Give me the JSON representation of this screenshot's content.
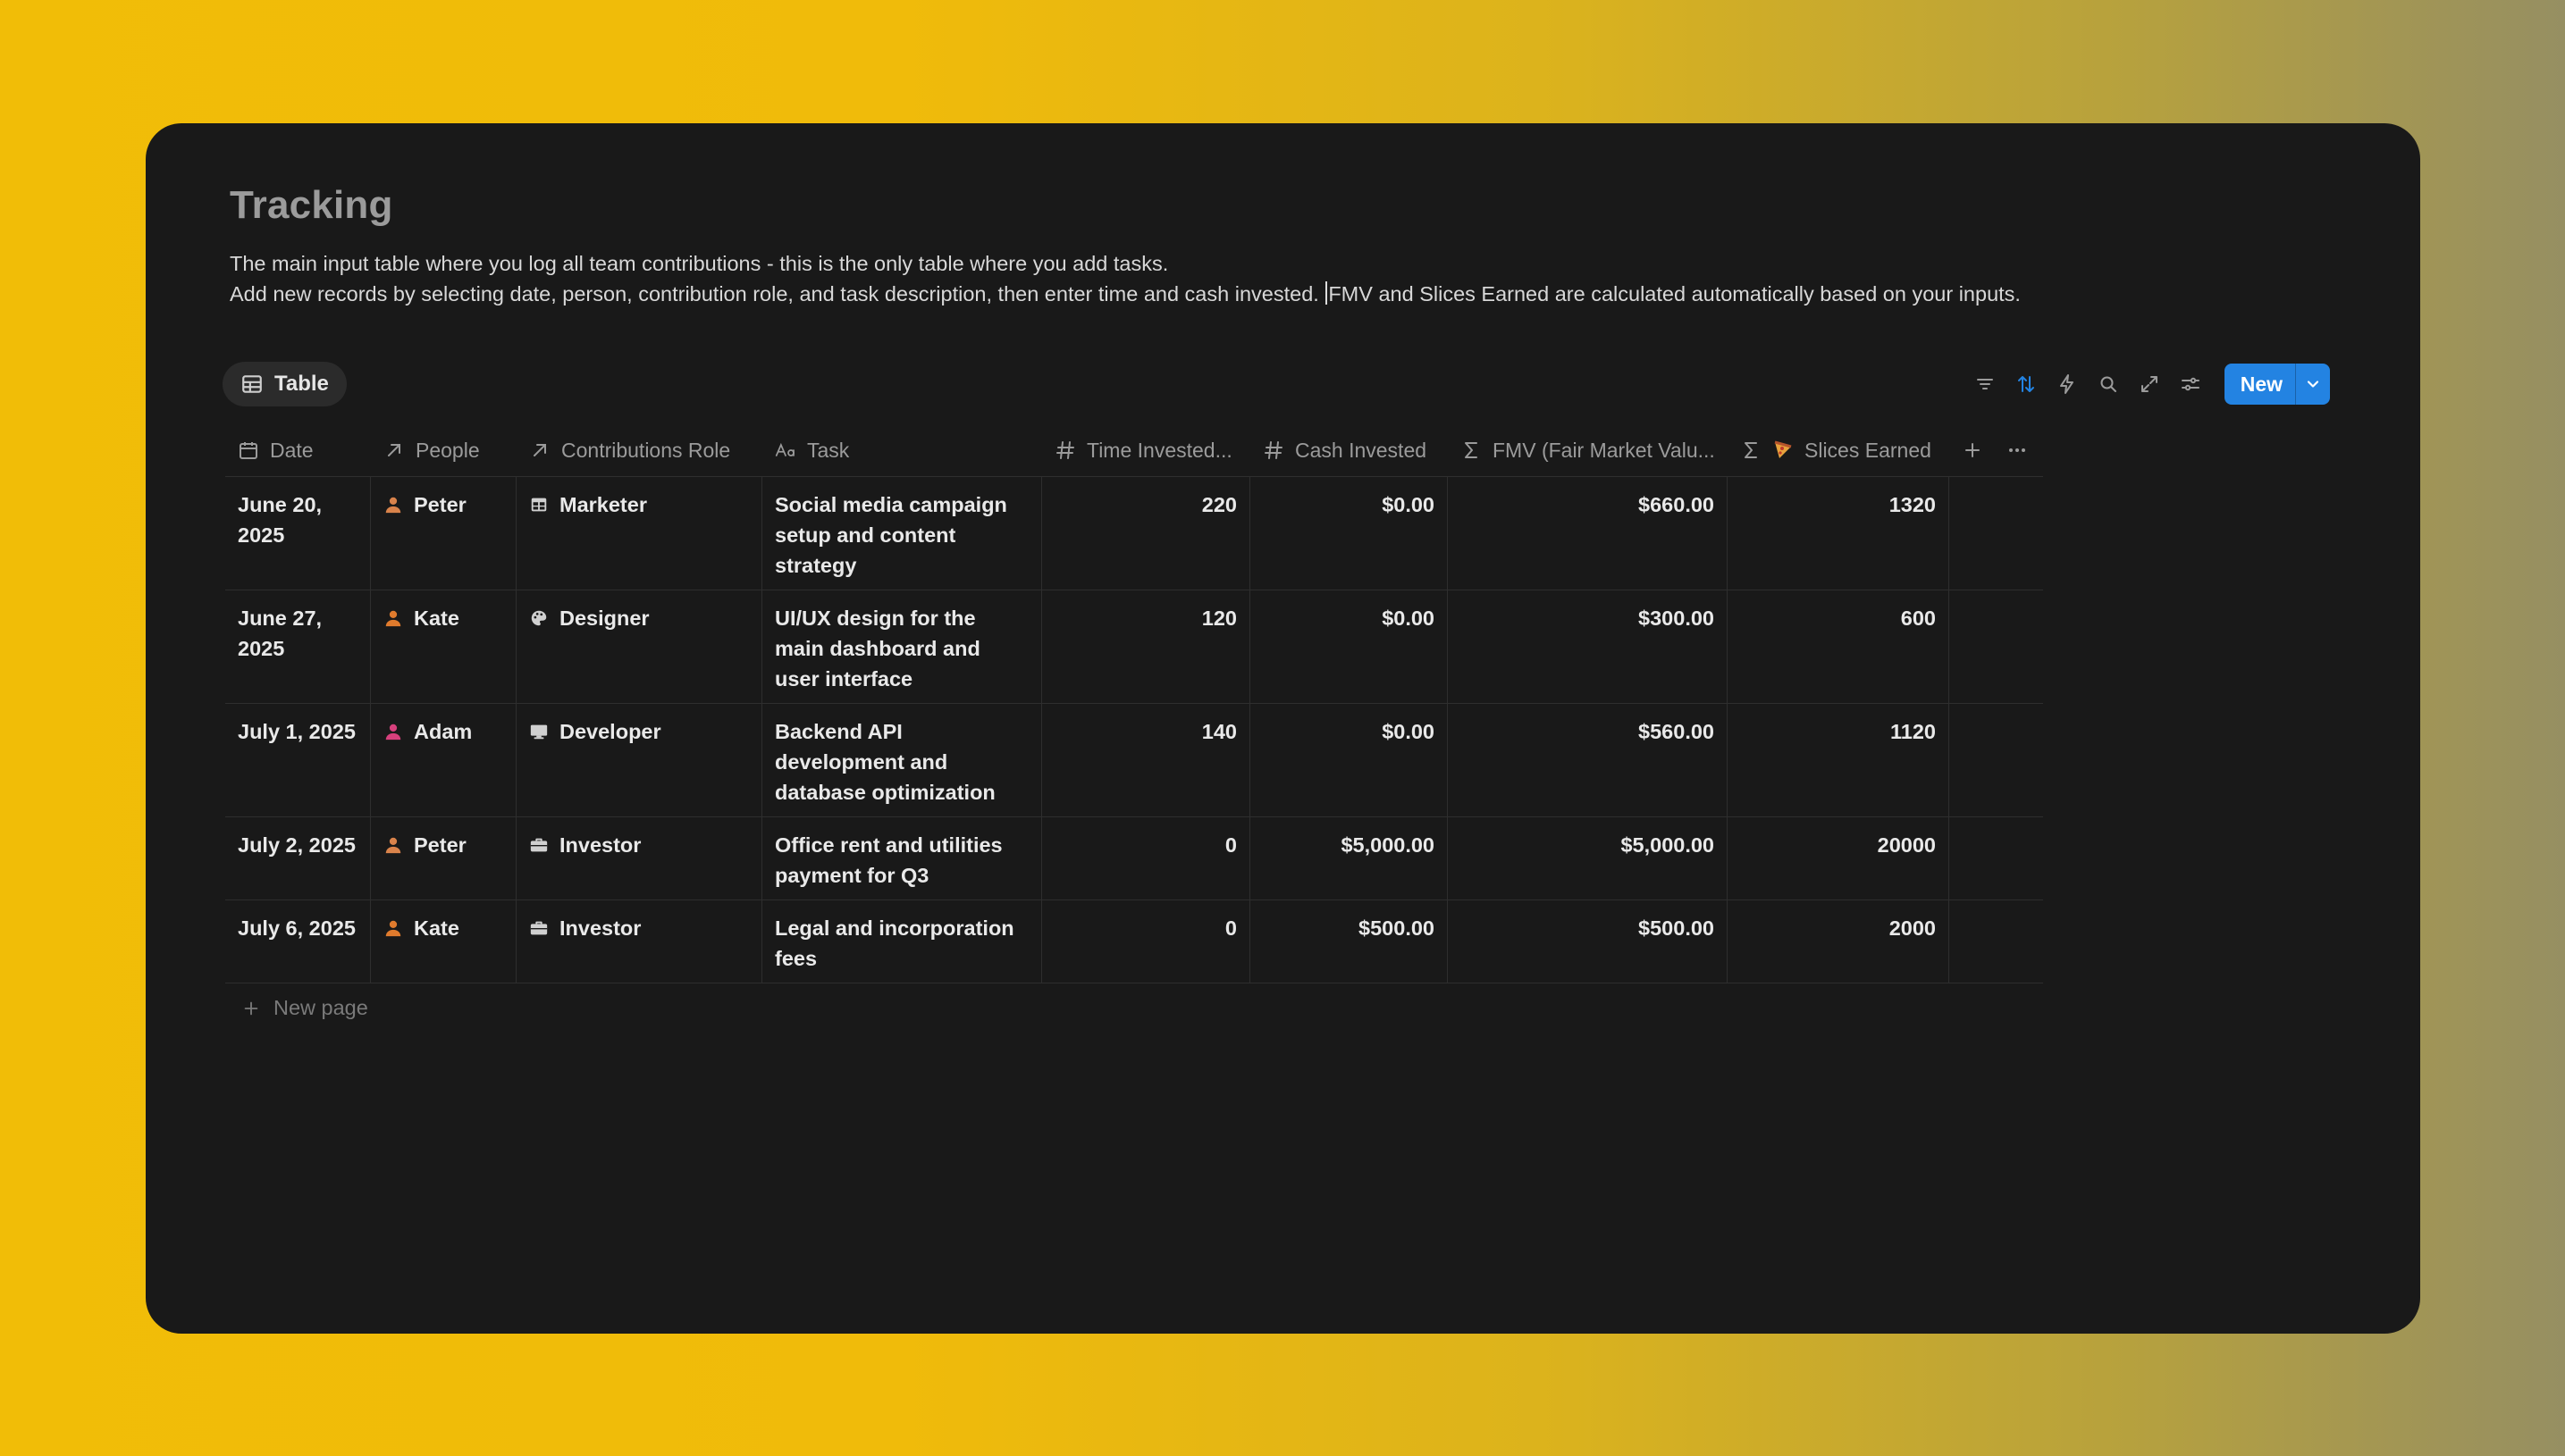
{
  "page": {
    "title": "Tracking",
    "description_line1": "The main input table where you log all team contributions - this is the only table where you add tasks.",
    "description_line2a": "Add new records by selecting date, person, contribution role, and task description, then enter time and cash invested.",
    "description_line2b": "FMV and Slices Earned are calculated automatically based on your inputs."
  },
  "view": {
    "tab_label": "Table",
    "tab_icon": "table-icon"
  },
  "toolbar": {
    "icons": [
      "filter-icon",
      "sort-icon",
      "automation-icon",
      "search-icon",
      "expand-icon",
      "settings-icon"
    ],
    "new_label": "New",
    "accent": "#2383e2"
  },
  "columns": {
    "date": "Date",
    "people": "People",
    "role": "Contributions Role",
    "task": "Task",
    "time": "Time Invested...",
    "cash": "Cash Invested",
    "fmv": "FMV (Fair Market Valu...",
    "slices": "Slices Earned"
  },
  "rows": [
    {
      "date": "June 20, 2025",
      "person": "Peter",
      "person_color": "#d9834b",
      "role": "Marketer",
      "role_icon": "table-icon",
      "task": "Social media campaign setup and content strategy",
      "time": "220",
      "cash": "$0.00",
      "fmv": "$660.00",
      "slices": "1320"
    },
    {
      "date": "June 27, 2025",
      "person": "Kate",
      "person_color": "#e07b2d",
      "role": "Designer",
      "role_icon": "palette-icon",
      "task": "UI/UX design for the main dashboard and user interface",
      "time": "120",
      "cash": "$0.00",
      "fmv": "$300.00",
      "slices": "600"
    },
    {
      "date": "July 1, 2025",
      "person": "Adam",
      "person_color": "#d6407c",
      "role": "Developer",
      "role_icon": "computer-icon",
      "task": "Backend API development and database optimization",
      "time": "140",
      "cash": "$0.00",
      "fmv": "$560.00",
      "slices": "1120"
    },
    {
      "date": "July 2, 2025",
      "person": "Peter",
      "person_color": "#d9834b",
      "role": "Investor",
      "role_icon": "briefcase-icon",
      "task": "Office rent and utilities payment for Q3",
      "time": "0",
      "cash": "$5,000.00",
      "fmv": "$5,000.00",
      "slices": "20000"
    },
    {
      "date": "July 6, 2025",
      "person": "Kate",
      "person_color": "#e07b2d",
      "role": "Investor",
      "role_icon": "briefcase-icon",
      "task": "Legal and incorporation fees",
      "time": "0",
      "cash": "$500.00",
      "fmv": "$500.00",
      "slices": "2000"
    }
  ],
  "new_page_label": "New page"
}
